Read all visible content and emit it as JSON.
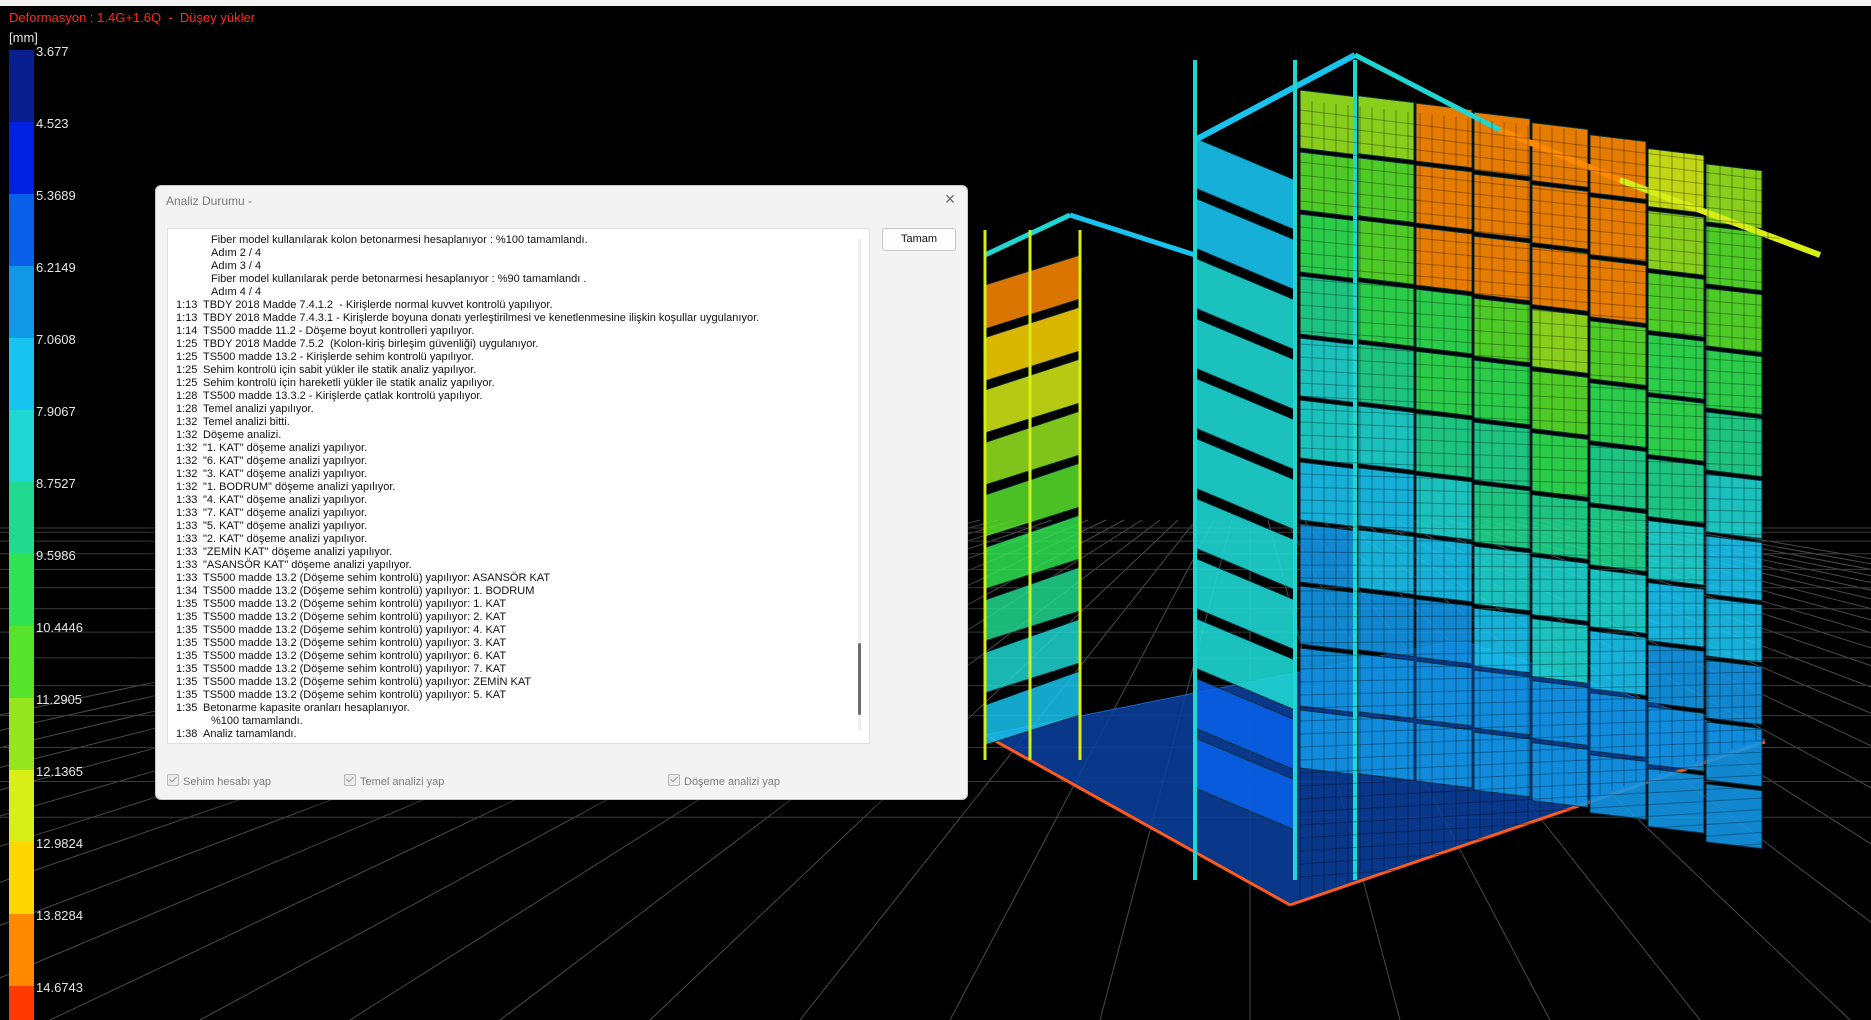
{
  "viewport": {
    "title": "Deformasyon : 1.4G+1.6Q  -  Düşey yükler",
    "unit": "[mm]",
    "legend": [
      {
        "value": "3.677",
        "color": "#0a1f8f"
      },
      {
        "value": "4.523",
        "color": "#0022e0"
      },
      {
        "value": "5.3689",
        "color": "#0a5fe8"
      },
      {
        "value": "6.2149",
        "color": "#1296e6"
      },
      {
        "value": "7.0608",
        "color": "#19c3f0"
      },
      {
        "value": "7.9067",
        "color": "#1fd6d2"
      },
      {
        "value": "8.7527",
        "color": "#21d98f"
      },
      {
        "value": "9.5986",
        "color": "#2fe352"
      },
      {
        "value": "10.4446",
        "color": "#57e22b"
      },
      {
        "value": "11.2905",
        "color": "#97e51f"
      },
      {
        "value": "12.1365",
        "color": "#d8ee17"
      },
      {
        "value": "12.9824",
        "color": "#ffd700"
      },
      {
        "value": "13.8284",
        "color": "#ff8a00"
      },
      {
        "value": "14.6743",
        "color": "#ff3a00"
      }
    ]
  },
  "dialog": {
    "title": "Analiz Durumu -",
    "ok_label": "Tamam",
    "log": [
      {
        "t": "",
        "text": "Fiber model kullanılarak kolon betonarmesi hesaplanıyor : %100 tamamlandı.",
        "indent": true
      },
      {
        "t": "",
        "text": "Adım 2 / 4",
        "indent": true
      },
      {
        "t": "",
        "text": "Adım 3 / 4",
        "indent": true
      },
      {
        "t": "",
        "text": "Fiber model kullanılarak perde betonarmesi hesaplanıyor : %90 tamamlandı .",
        "indent": true
      },
      {
        "t": "",
        "text": "Adım 4 / 4",
        "indent": true
      },
      {
        "t": "1:13",
        "text": "TBDY 2018 Madde 7.4.1.2  - Kirişlerde normal kuvvet kontrolü yapılıyor."
      },
      {
        "t": "1:13",
        "text": "TBDY 2018 Madde 7.4.3.1 - Kirişlerde boyuna donatı yerleştirilmesi ve kenetlenmesine ilişkin koşullar uygulanıyor."
      },
      {
        "t": "1:14",
        "text": "TS500 madde 11.2 - Döşeme boyut kontrolleri yapılıyor."
      },
      {
        "t": "1:25",
        "text": "TBDY 2018 Madde 7.5.2  (Kolon-kiriş birleşim güvenliği) uygulanıyor."
      },
      {
        "t": "1:25",
        "text": "TS500 madde 13.2 - Kirişlerde sehim kontrolü yapılıyor."
      },
      {
        "t": "1:25",
        "text": "Sehim kontrolü için sabit yükler ile statik analiz yapılıyor."
      },
      {
        "t": "1:25",
        "text": "Sehim kontrolü için hareketli yükler ile statik analiz yapılıyor."
      },
      {
        "t": "1:28",
        "text": "TS500 madde 13.3.2 - Kirişlerde çatlak kontrolü yapılıyor."
      },
      {
        "t": "1:28",
        "text": "Temel analizi yapılıyor."
      },
      {
        "t": "1:32",
        "text": "Temel analizi bitti."
      },
      {
        "t": "1:32",
        "text": "Döşeme analizi."
      },
      {
        "t": "1:32",
        "text": "\"1. KAT\" döşeme analizi yapılıyor."
      },
      {
        "t": "1:32",
        "text": "\"6. KAT\" döşeme analizi yapılıyor."
      },
      {
        "t": "1:32",
        "text": "\"3. KAT\" döşeme analizi yapılıyor."
      },
      {
        "t": "1:32",
        "text": "\"1. BODRUM\" döşeme analizi yapılıyor."
      },
      {
        "t": "1:33",
        "text": "\"4. KAT\" döşeme analizi yapılıyor."
      },
      {
        "t": "1:33",
        "text": "\"7. KAT\" döşeme analizi yapılıyor."
      },
      {
        "t": "1:33",
        "text": "\"5. KAT\" döşeme analizi yapılıyor."
      },
      {
        "t": "1:33",
        "text": "\"2. KAT\" döşeme analizi yapılıyor."
      },
      {
        "t": "1:33",
        "text": "\"ZEMİN KAT\" döşeme analizi yapılıyor."
      },
      {
        "t": "1:33",
        "text": "\"ASANSÖR KAT\" döşeme analizi yapılıyor."
      },
      {
        "t": "1:33",
        "text": "TS500 madde 13.2 (Döşeme sehim kontrolü) yapılıyor: ASANSÖR KAT"
      },
      {
        "t": "1:34",
        "text": "TS500 madde 13.2 (Döşeme sehim kontrolü) yapılıyor: 1. BODRUM"
      },
      {
        "t": "1:35",
        "text": "TS500 madde 13.2 (Döşeme sehim kontrolü) yapılıyor: 1. KAT"
      },
      {
        "t": "1:35",
        "text": "TS500 madde 13.2 (Döşeme sehim kontrolü) yapılıyor: 2. KAT"
      },
      {
        "t": "1:35",
        "text": "TS500 madde 13.2 (Döşeme sehim kontrolü) yapılıyor: 4. KAT"
      },
      {
        "t": "1:35",
        "text": "TS500 madde 13.2 (Döşeme sehim kontrolü) yapılıyor: 3. KAT"
      },
      {
        "t": "1:35",
        "text": "TS500 madde 13.2 (Döşeme sehim kontrolü) yapılıyor: 6. KAT"
      },
      {
        "t": "1:35",
        "text": "TS500 madde 13.2 (Döşeme sehim kontrolü) yapılıyor: 7. KAT"
      },
      {
        "t": "1:35",
        "text": "TS500 madde 13.2 (Döşeme sehim kontrolü) yapılıyor: ZEMİN KAT"
      },
      {
        "t": "1:35",
        "text": "TS500 madde 13.2 (Döşeme sehim kontrolü) yapılıyor: 5. KAT"
      },
      {
        "t": "1:35",
        "text": "Betonarme kapasite oranları hesaplanıyor."
      },
      {
        "t": "",
        "text": "%100 tamamlandı.",
        "indent": true
      },
      {
        "t": "1:38",
        "text": "Analiz tamamlandı."
      }
    ],
    "options": [
      {
        "label": "Sehim hesabı yap",
        "checked": true
      },
      {
        "label": "Temel analizi yap",
        "checked": true
      },
      {
        "label": "Döşeme analizi yap",
        "checked": true
      }
    ]
  }
}
